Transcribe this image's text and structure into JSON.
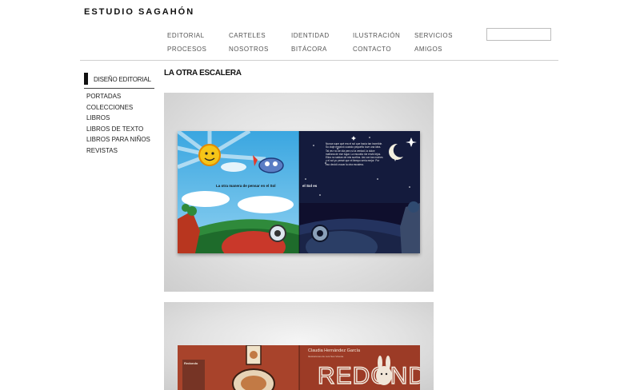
{
  "site": {
    "title": "ESTUDIO SAGAHÓN"
  },
  "nav": {
    "row1": [
      "EDITORIAL",
      "CARTELES",
      "IDENTIDAD",
      "ILUSTRACIÓN",
      "SERVICIOS"
    ],
    "row2": [
      "PROCESOS",
      "NOSOTROS",
      "BITÁCORA",
      "CONTACTO",
      "AMIGOS"
    ]
  },
  "search": {
    "value": ""
  },
  "sidebar": {
    "heading": "DISEÑO EDITORIAL",
    "items": [
      "PORTADAS",
      "COLECCIONES",
      "LIBROS",
      "LIBROS DE TEXTO",
      "LIBROS PARA NIÑOS",
      "REVISTAS"
    ]
  },
  "main": {
    "heading": "LA OTRA ESCALERA",
    "spread1": {
      "left_caption": "La otra manera de pensar en el Sol",
      "right_caption": "el Sol es",
      "right_body": "Nunca supe qué era el sol que hacía tan increíble. Su viaje empezó cuando pequeño tuve una idea. Tal vez no de día pero sí la verdad, la dulce mañana de ese lugar. La escuela me envió lejos. Ellos no sabían de mis sueños. Así con las noches y el sol yo pensé que el tiempo sería mejor. Por eso decidí cruzar la otra escalera."
    },
    "spread2": {
      "title": "REDONDO",
      "author": "Claudia Hernández García",
      "credit": "Ilustraciones de Luis San Vicente",
      "small_title": "Redondo"
    }
  }
}
